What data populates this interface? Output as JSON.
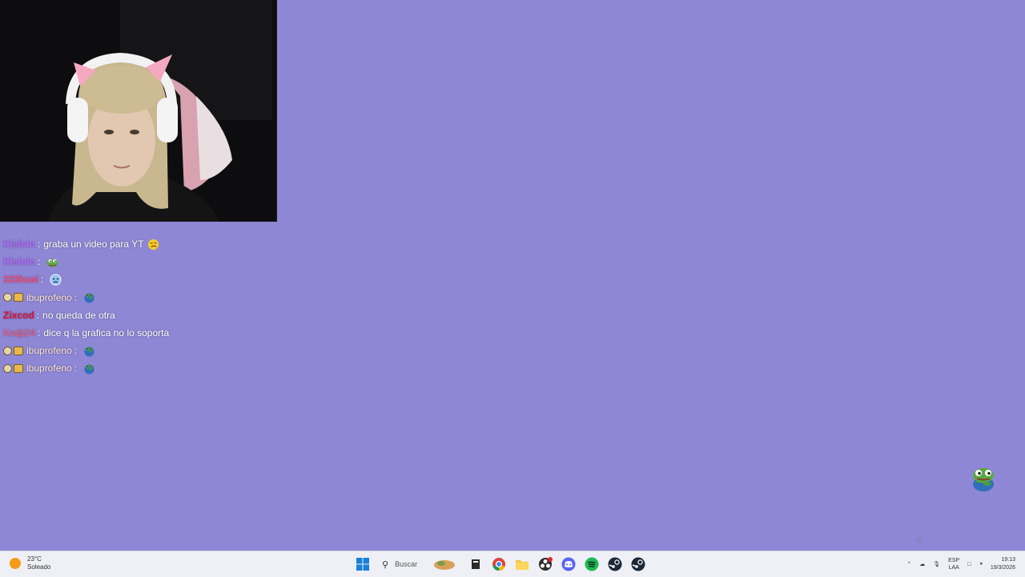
{
  "chat": [
    {
      "user": "Kish4n",
      "user_color": "#b36bff",
      "badges": [],
      "message": "graba un video para YT",
      "emote": "smirk-emote"
    },
    {
      "user": "Kish4n",
      "user_color": "#b36bff",
      "badges": [],
      "message": "",
      "emote": "pepe-emote"
    },
    {
      "user": "333kusi",
      "user_color": "#ff4f7e",
      "badges": [],
      "message": "",
      "emote": "sad-emote"
    },
    {
      "user": "ibuprofeno",
      "user_color": "#ffe6d6",
      "badges": [
        "circle-badge",
        "gift-badge"
      ],
      "message": "",
      "emote": "pepe-earth-emote"
    },
    {
      "user": "Zixcod",
      "user_color": "#e0103c",
      "badges": [],
      "message": "no queda de otra",
      "emote": ""
    },
    {
      "user": "Kodji24",
      "user_color": "#ff5a7a",
      "badges": [],
      "message": "dice q la grafica no lo soporta",
      "emote": ""
    },
    {
      "user": "ibuprofeno",
      "user_color": "#ffe6d6",
      "badges": [
        "circle-badge",
        "gift-badge"
      ],
      "message": "",
      "emote": "pepe-earth-emote"
    },
    {
      "user": "ibuprofeno",
      "user_color": "#ffe6d6",
      "badges": [
        "circle-badge",
        "gift-badge"
      ],
      "message": "",
      "emote": "pepe-earth-emote"
    }
  ],
  "weather": {
    "temp": "23°C",
    "condition": "Soleado"
  },
  "taskbar": {
    "search_placeholder": "Buscar",
    "apps": [
      "start-icon",
      "search",
      "file-icon",
      "chrome-icon",
      "explorer-icon",
      "obs-icon",
      "discord-icon",
      "spotify-icon",
      "steam-icon",
      "steam-icon"
    ]
  },
  "tray": {
    "lang_top": "ESP",
    "lang_bottom": "LAA",
    "time": "19:13",
    "date": "19/3/2026"
  },
  "colors": {
    "background": "#8e87d6",
    "taskbar": "#eef0f5"
  }
}
